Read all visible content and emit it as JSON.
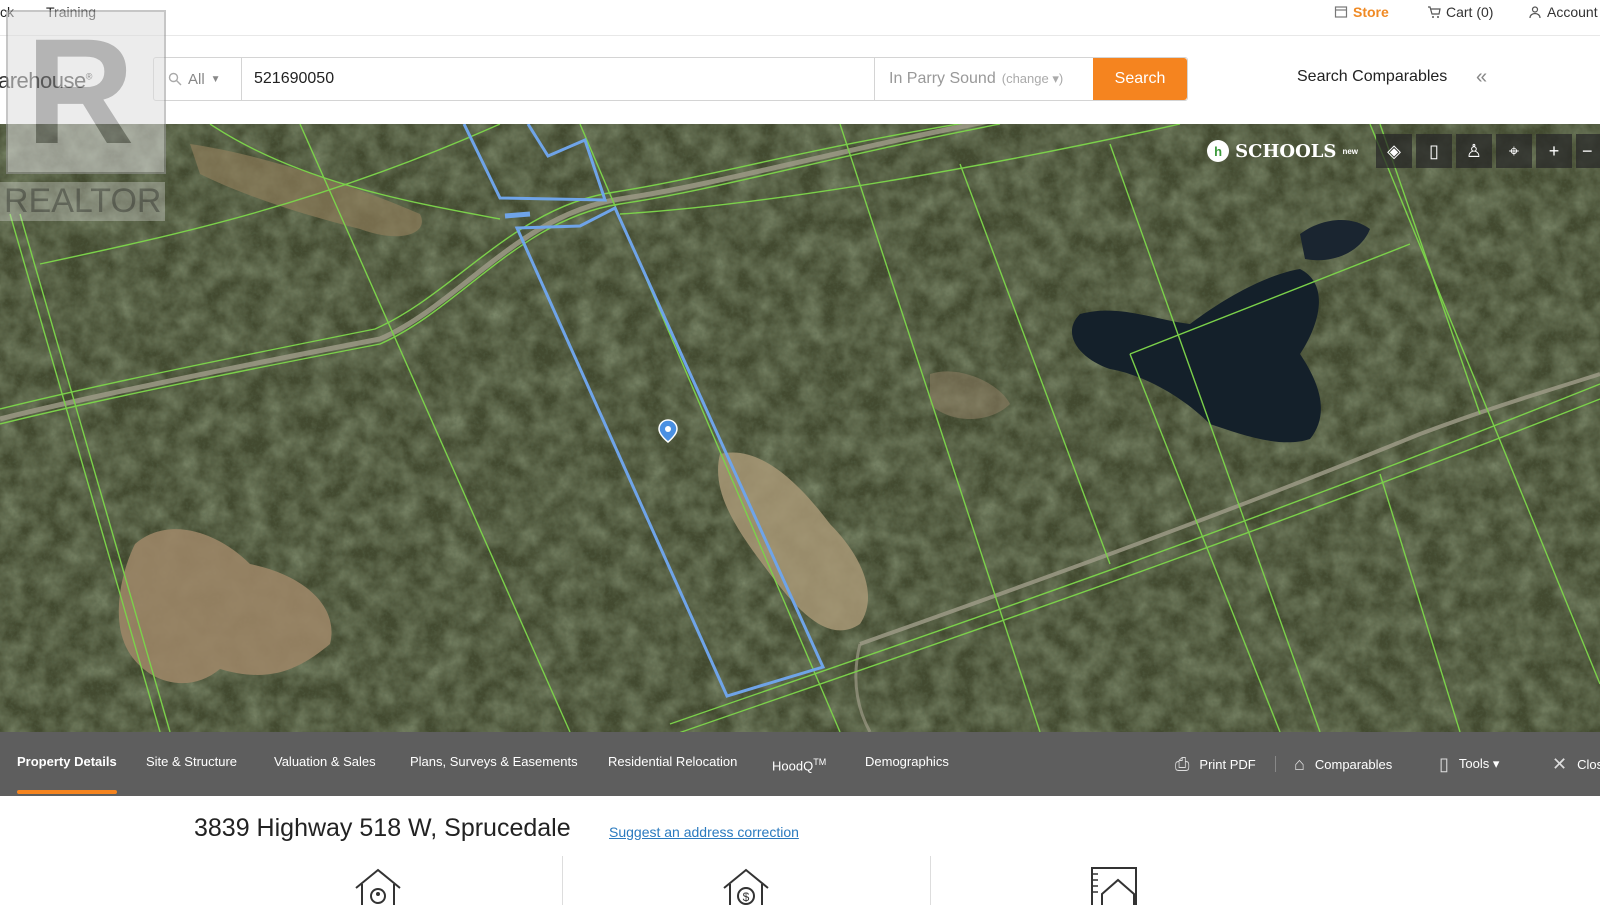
{
  "topbar": {
    "left_links": [
      "ck",
      "Training"
    ],
    "store": "Store",
    "cart": "Cart (0)",
    "account": "Account"
  },
  "brand": {
    "partial": "arehouse",
    "reg": "®"
  },
  "search": {
    "scope": "All",
    "query": "521690050",
    "area": "In Parry Sound",
    "change_label": "(change ▾)",
    "button": "Search"
  },
  "comparables_link": "Search Comparables",
  "map": {
    "schools_label": "SCHOOLS",
    "schools_badge": "new",
    "tools": [
      "layers-icon",
      "map-icon",
      "street-view-icon",
      "locate-icon",
      "zoom-in-icon",
      "zoom-out-icon"
    ]
  },
  "watermark": {
    "text": "REALTOR"
  },
  "tabs": [
    {
      "label": "Property Details",
      "active": true
    },
    {
      "label": "Site & Structure"
    },
    {
      "label": "Valuation & Sales"
    },
    {
      "label": "Plans, Surveys & Easements"
    },
    {
      "label": "Residential Relocation"
    },
    {
      "label": "HoodQ",
      "sup": "TM"
    },
    {
      "label": "Demographics"
    }
  ],
  "actions": {
    "print": "Print PDF",
    "comparables": "Comparables",
    "tools": "Tools ▾",
    "close": "Clos"
  },
  "property": {
    "address": "3839 Highway 518 W, Sprucedale",
    "suggest": "Suggest an address correction"
  },
  "colors": {
    "accent": "#f5841f",
    "parcel_lines": "#7bd14a",
    "selected_parcel": "#6fa4e8"
  }
}
